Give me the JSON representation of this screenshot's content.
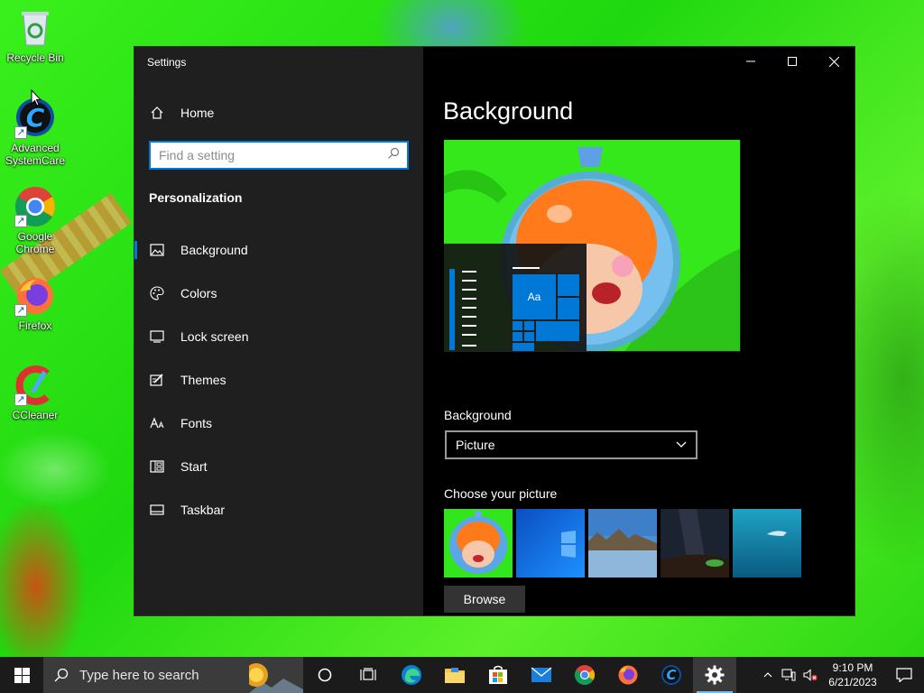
{
  "desktop": {
    "icons": [
      {
        "label": "Recycle Bin"
      },
      {
        "label": "Advanced SystemCare"
      },
      {
        "label": "Google Chrome"
      },
      {
        "label": "Firefox"
      },
      {
        "label": "CCleaner"
      }
    ]
  },
  "window": {
    "title": "Settings",
    "sidebar": {
      "home_label": "Home",
      "search_placeholder": "Find a setting",
      "section_header": "Personalization",
      "items": [
        {
          "label": "Background",
          "icon": "picture-icon",
          "selected": true
        },
        {
          "label": "Colors",
          "icon": "palette-icon"
        },
        {
          "label": "Lock screen",
          "icon": "lock-screen-icon"
        },
        {
          "label": "Themes",
          "icon": "themes-icon"
        },
        {
          "label": "Fonts",
          "icon": "fonts-icon"
        },
        {
          "label": "Start",
          "icon": "start-icon"
        },
        {
          "label": "Taskbar",
          "icon": "taskbar-icon"
        }
      ]
    },
    "content": {
      "page_title": "Background",
      "preview_tile_text": "Aa",
      "background_label": "Background",
      "background_value": "Picture",
      "choose_picture_label": "Choose your picture",
      "browse_label": "Browse"
    }
  },
  "taskbar": {
    "search_placeholder": "Type here to search",
    "time": "9:10 PM",
    "date": "6/21/2023"
  },
  "colors": {
    "accent": "#0078d7",
    "sidebar_bg": "#1f1f1f",
    "content_bg": "#000000",
    "taskbar_bg": "#1b1b1b"
  }
}
